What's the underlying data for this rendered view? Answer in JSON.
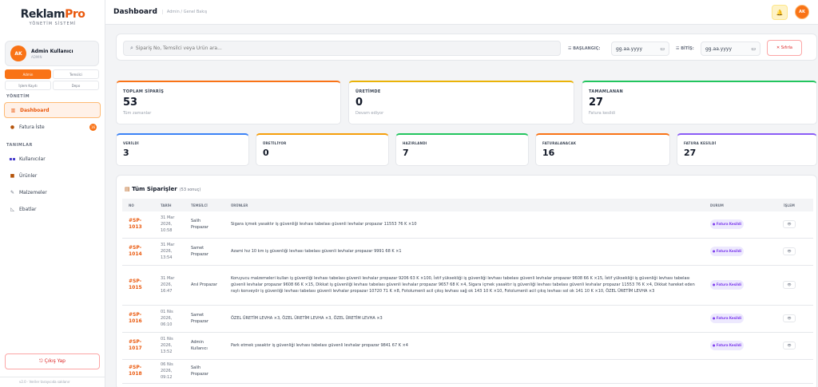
{
  "sidebar": {
    "brand_main": "Reklam",
    "brand_pro": "Pro",
    "brand_sub": "YÖNETİM SİSTEMİ",
    "user": {
      "initials": "AK",
      "name": "Admin Kullanıcı",
      "role": "ADMIN"
    },
    "roles": [
      "Admin",
      "Temsilci",
      "İşlem Kayıtı",
      "Depo"
    ],
    "section_yonetim": "YÖNETİM",
    "section_tanimlar": "TANIMLAR",
    "nav_dashboard": "Dashboard",
    "nav_fatura": "Fatura İste",
    "nav_fatura_badge": "16",
    "nav_kullanicilar": "Kullanıcılar",
    "nav_urunler": "Ürünler",
    "nav_malzemeler": "Malzemeler",
    "nav_ebatlar": "Ebatlar",
    "logout": "⎋ Çıkış Yap",
    "footer": "v2.0 · Veriler tarayıcıda saklanır"
  },
  "topbar": {
    "title": "Dashboard",
    "breadcrumb": "Admin / Genel Bakış",
    "avatar_initials": "AK"
  },
  "filter": {
    "search_placeholder": "Sipariş No, Temsilci veya Ürün ara...",
    "start_label": "☰ BAŞLANGIÇ:",
    "end_label": "☰ BİTİŞ:",
    "date_placeholder": "gg.aa.yyyy",
    "reset": "✕ Sıfırla"
  },
  "big_stats": [
    {
      "label": "TOPLAM SİPARİŞ",
      "value": "53",
      "desc": "Tüm zamanlar",
      "color": "#f97316"
    },
    {
      "label": "ÜRETİMDE",
      "value": "0",
      "desc": "Devam ediyor",
      "color": "#eab308"
    },
    {
      "label": "TAMAMLANAN",
      "value": "27",
      "desc": "Fatura kesildi",
      "color": "#22c55e"
    }
  ],
  "small_stats": [
    {
      "label": "VERİLDİ",
      "value": "3",
      "color": "#3b82f6"
    },
    {
      "label": "ÜRETİLİYOR",
      "value": "0",
      "color": "#f59e0b"
    },
    {
      "label": "HAZIRLANDI",
      "value": "7",
      "color": "#22c55e"
    },
    {
      "label": "FATURALANACAK",
      "value": "16",
      "color": "#f97316"
    },
    {
      "label": "FATURA KESİLDİ",
      "value": "27",
      "color": "#8b5cf6"
    }
  ],
  "orders": {
    "title": "Tüm Siparişler",
    "count": "(53 sonuç)",
    "columns": [
      "NO",
      "TARİH",
      "TEMSİLCİ",
      "ÜRÜNLER",
      "DURUM",
      "İŞLEM"
    ],
    "status_label": "● Fatura Kesildi",
    "action_label": "👁",
    "rows": [
      {
        "no": "#SP-1013",
        "date": "31 Mar 2026, 10:58",
        "rep": "Salih Propazar",
        "products": "Sigara içmek yasaktır iş güvenliği levhası tabelası güvenli levhalar propazar 11553 76 K ×10"
      },
      {
        "no": "#SP-1014",
        "date": "31 Mar 2026, 13:54",
        "rep": "Samet Propazar",
        "products": "Azami hız 10 km iş güvenliği levhası tabelası güvenli levhalar propazar 9991 68 K ×1"
      },
      {
        "no": "#SP-1015",
        "date": "31 Mar 2026, 16:47",
        "rep": "Anıl Propazar",
        "products": "Koruyucu malzemeleri kullan iş güvenliği levhası tabelası güvenli levhalar propazar 9206 63 K ×100, İstif yüksekliği iş güvenliği levhası tabelası güvenli levhalar propazar 9608 66 K ×15, İstif yüksekliği iş güvenliği levhası tabelası güvenli levhalar propazar 9608 66 K ×15, Dikkat iş güvenliği levhası tabelası güvenli levhalar propazar 9657 68 K ×4, Sigara içmek yasaktır iş güvenliği levhası tabelası güvenli levhalar propazar 11553 76 K ×4, Dikkat hareket eden raylı konveyör iş güvenliği levhası tabelası güvenli levhalar propazar 10720 71 K ×8, Fotolumenli acil çıkış levhası sağ ok 143 10 K ×10, Fotolumenli acil çıkış levhası sol ok 141 10 K ×10, ÖZEL ÜRETİM LEVHA ×3"
      },
      {
        "no": "#SP-1016",
        "date": "01 Nis 2026, 06:10",
        "rep": "Samet Propazar",
        "products": "ÖZEL ÜRETİM LEVHA ×3, ÖZEL ÜRETİM LEVHA ×3, ÖZEL ÜRETİM LEVHA ×3"
      },
      {
        "no": "#SP-1017",
        "date": "01 Nis 2026, 13:52",
        "rep": "Admin Kullanıcı",
        "products": "Park etmek yasaktır iş güvenliği levhası tabelası güvenli levhalar propazar 9841 67 K ×4"
      },
      {
        "no": "#SP-1018",
        "date": "06 Nis 2026, 09:12",
        "rep": "Salih Propazar",
        "products": ""
      }
    ]
  }
}
